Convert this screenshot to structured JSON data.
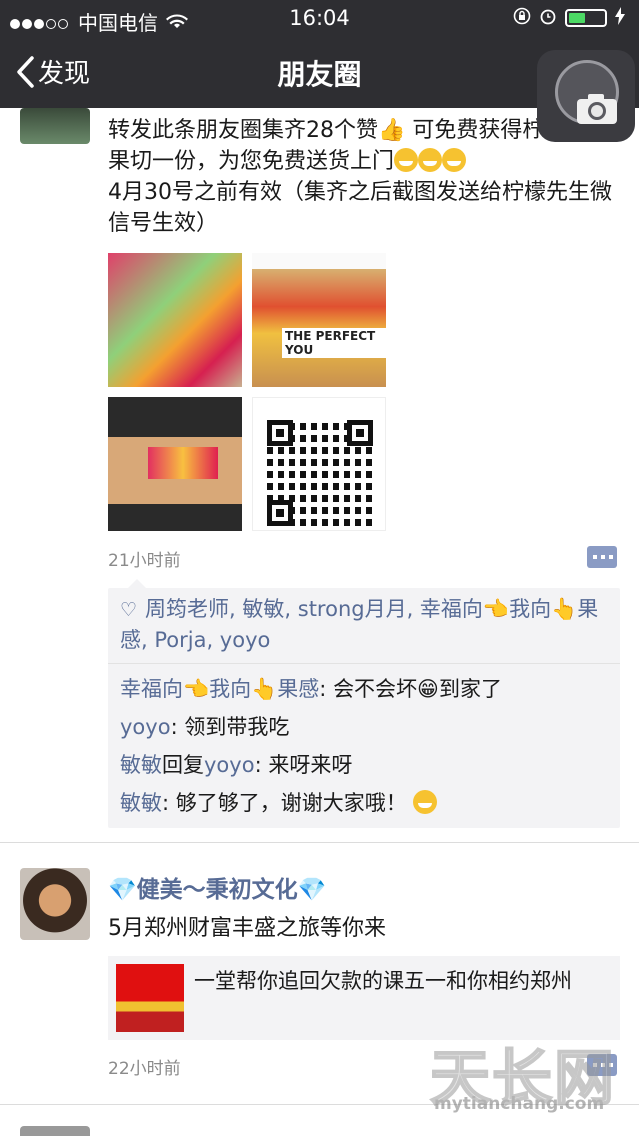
{
  "status": {
    "carrier": "中国电信",
    "time": "16:04"
  },
  "nav": {
    "back_label": "发现",
    "title": "朋友圈"
  },
  "post1": {
    "text_a": "转发此条朋友圈集齐28个赞",
    "text_b": " 可免费获得柠檬先生果切一份，为您免费送货上门",
    "text_c": "4月30号之前有效（集齐之后截图发送给柠檬先生微信号生效）",
    "photo2_caption": "THE PERFECT YOU",
    "time": "21小时前",
    "likes": "周筠老师, 敏敏, strong月月, 幸福向👈我向👆果感, Porja, yoyo",
    "comments": [
      {
        "user": "幸福向👈我向👆果感",
        "sep": ": ",
        "text": "会不会坏😁到家了"
      },
      {
        "user": "yoyo",
        "sep": ": ",
        "text": "领到带我吃"
      },
      {
        "user": "敏敏",
        "reply": "回复",
        "to": "yoyo",
        "sep": ": ",
        "text": "来呀来呀"
      },
      {
        "user": "敏敏",
        "sep": ": ",
        "text": "够了够了，谢谢大家哦！"
      }
    ]
  },
  "post2": {
    "name": "💎健美～秉初文化💎",
    "text": "5月郑州财富丰盛之旅等你来",
    "share_text": "一堂帮你追回欠款的课五一和你相约郑州",
    "time": "22小时前"
  },
  "watermark": {
    "big": "天长网",
    "small": "mytianchang.com"
  }
}
